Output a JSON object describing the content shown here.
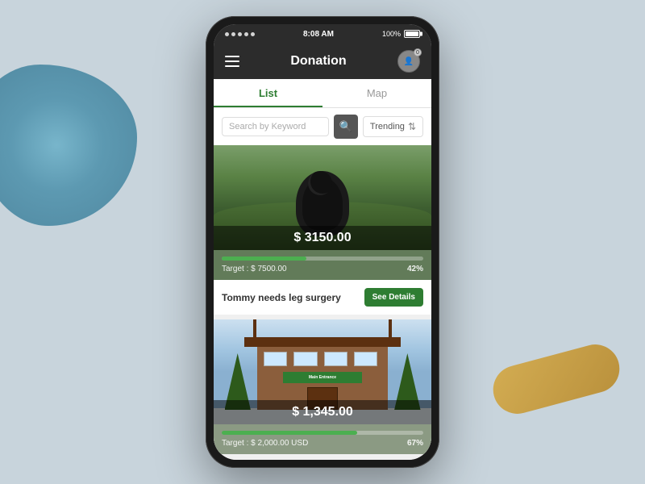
{
  "background": {
    "color": "#c8d4dc"
  },
  "status_bar": {
    "dots": 5,
    "time": "8:08 AM",
    "battery_percent": "100%"
  },
  "header": {
    "title": "Donation",
    "hamburger_label": "menu",
    "profile_badge": "0"
  },
  "tabs": [
    {
      "label": "List",
      "active": true
    },
    {
      "label": "Map",
      "active": false
    }
  ],
  "search": {
    "placeholder": "Search by Keyword",
    "sort_label": "Trending"
  },
  "cards": [
    {
      "amount": "$ 3150.00",
      "target_text": "Target : $ 7500.00",
      "percent": "42%",
      "progress": 42,
      "title": "Tommy needs leg surgery",
      "cta_label": "See Details"
    },
    {
      "amount": "$ 1,345.00",
      "target_text": "Target : $ 2,000.00 USD",
      "percent": "67%",
      "progress": 67,
      "title": "",
      "cta_label": ""
    }
  ]
}
